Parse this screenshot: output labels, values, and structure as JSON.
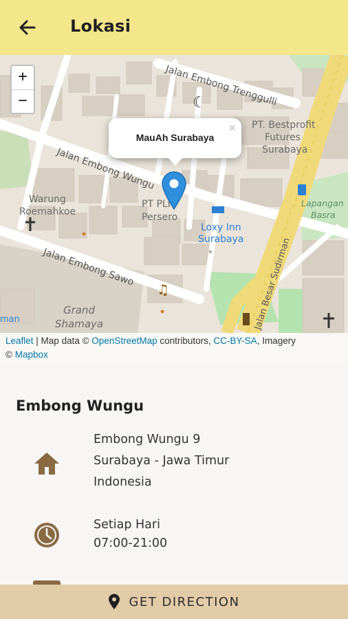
{
  "appbar": {
    "title": "Lokasi",
    "back_icon": "arrow-back-icon"
  },
  "map": {
    "zoom_in": "+",
    "zoom_out": "−",
    "popup_title": "MauAh Surabaya",
    "popup_close": "×",
    "labels": {
      "street_trenggulli": "Jalan Embong Trenggulli",
      "street_wungu": "Jalan Embong Wungu",
      "street_sawo": "Jalan Embong Sawo",
      "street_sudirman": "Jalan Besar Sudirman",
      "bestprofit_1": "PT. Bestprofit",
      "bestprofit_2": "Futures",
      "bestprofit_3": "Surabaya",
      "warung_1": "Warung",
      "warung_2": "Roemahkoe",
      "ptpln_1": "PT PLN",
      "ptpln_2": "Persero",
      "loxy_1": "Loxy Inn",
      "loxy_2": "Surabaya",
      "lapangan_1": "Lapangan",
      "lapangan_2": "Basra",
      "grand_1": "Grand",
      "grand_2": "Shamaya",
      "edge_left": "man"
    },
    "attribution": {
      "leaflet": "Leaflet",
      "sep1": " | Map data © ",
      "osm": "OpenStreetMap",
      "sep2": " contributors, ",
      "license": "CC-BY-SA",
      "sep3": ", Imagery",
      "sep4": "© ",
      "mapbox": "Mapbox"
    },
    "marker_color": "#2f8fdc"
  },
  "info": {
    "place_name": "Embong Wungu",
    "address": {
      "icon": "home-icon",
      "line1": "Embong Wungu 9",
      "line2": "Surabaya - Jawa Timur",
      "line3": "Indonesia"
    },
    "hours": {
      "icon": "clock-icon",
      "line1": "Setiap Hari",
      "line2": "07:00-21:00"
    },
    "icon_color": "#8a6a43"
  },
  "bottom_button": {
    "label": "GET DIRECTION",
    "icon": "location-pin-icon"
  },
  "colors": {
    "appbar": "#f3e68b",
    "button": "#e2cca8"
  }
}
